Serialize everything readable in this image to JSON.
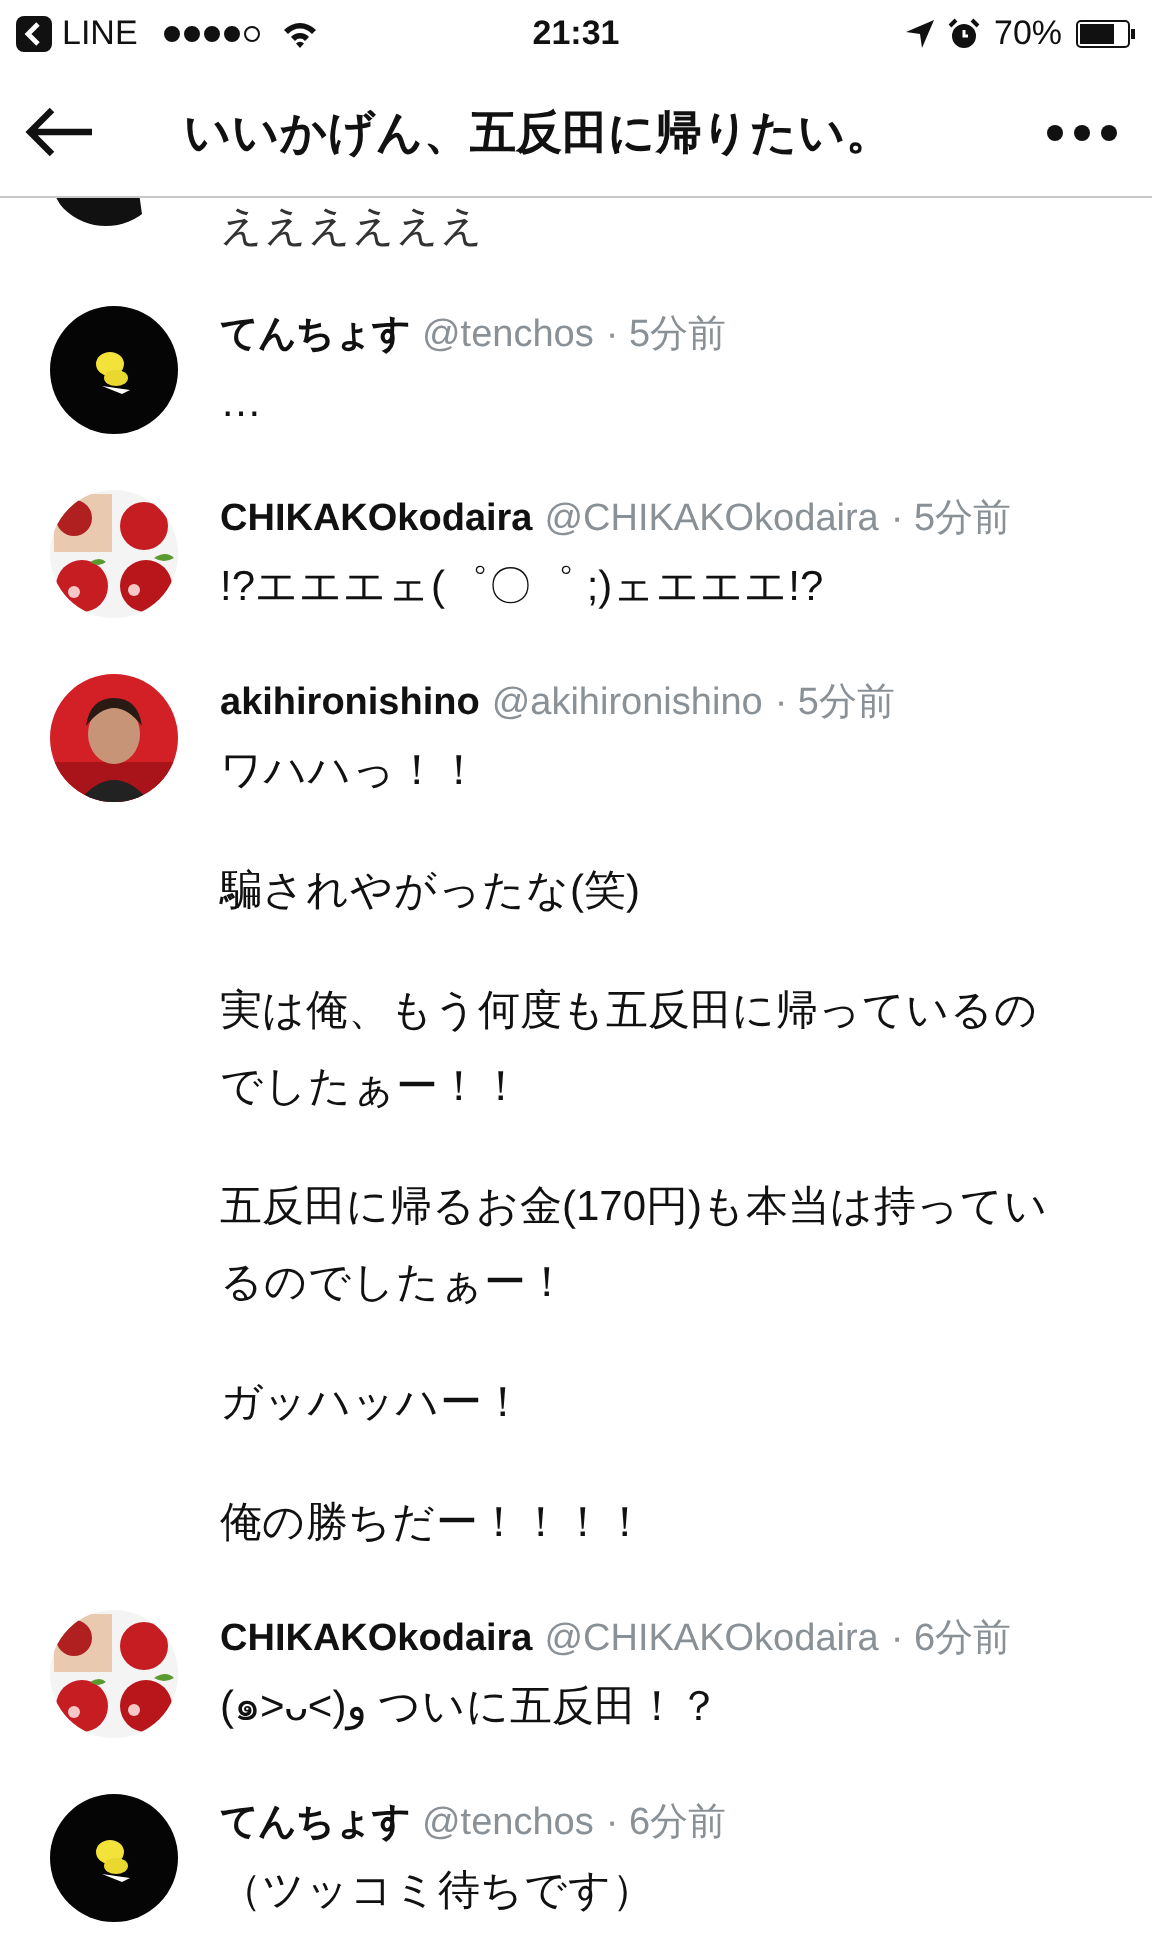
{
  "status_bar": {
    "back_app": "LINE",
    "time": "21:31",
    "battery": "70%"
  },
  "nav": {
    "title": "いいかげん、五反田に帰りたい。"
  },
  "replies": [
    {
      "body": [
        "ええええええ"
      ]
    },
    {
      "name": "てんちょす",
      "handle": "@tenchos",
      "time": "· 5分前",
      "body": [
        "…"
      ]
    },
    {
      "name": "CHIKAKOkodaira",
      "handle": "@CHIKAKOkodaira",
      "time": "· 5分前",
      "body": [
        "!?エエエェ(゜〇゜ ;)ェエエエ!?"
      ]
    },
    {
      "name": "akihironishino",
      "handle": "@akihironishino",
      "time": "· 5分前",
      "body": [
        "ワハハっ！！",
        "騙されやがったな(笑)",
        "実は俺、もう何度も五反田に帰っているのでしたぁー！！",
        "五反田に帰るお金(170円)も本当は持っているのでしたぁー！",
        "ガッハッハー！",
        "俺の勝ちだー！！！！"
      ]
    },
    {
      "name": "CHIKAKOkodaira",
      "handle": "@CHIKAKOkodaira",
      "time": "· 6分前",
      "body": [
        "(๑˃ᴗ˂)و ついに五反田！？"
      ]
    },
    {
      "name": "てんちょす",
      "handle": "@tenchos",
      "time": "· 6分前",
      "body": [
        "（ツッコミ待ちです）"
      ]
    }
  ]
}
